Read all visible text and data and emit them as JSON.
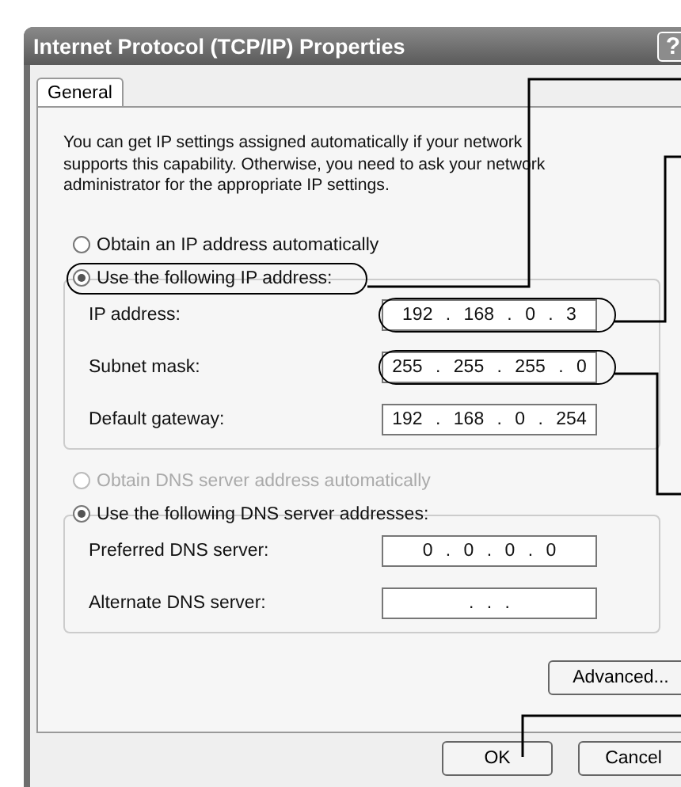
{
  "window": {
    "title": "Internet Protocol (TCP/IP) Properties",
    "title_buttons": [
      "?"
    ]
  },
  "tabs": [
    {
      "label": "General",
      "selected": true
    }
  ],
  "description": "You can get IP settings assigned automatically if your network supports this capability. Otherwise, you need to ask your network administrator for the appropriate IP settings.",
  "ip_options": [
    {
      "label": "Obtain an IP address automatically",
      "selected": false,
      "disabled": false
    },
    {
      "label": "Use the following IP address:",
      "selected": true,
      "disabled": false
    }
  ],
  "ip_fields": [
    {
      "label": "IP address:",
      "value": "192 . 168 . 0 . 3"
    },
    {
      "label": "Subnet mask:",
      "value": "255 . 255 . 255 . 0"
    },
    {
      "label": "Default gateway:",
      "value": "192 . 168 . 0 . 254"
    }
  ],
  "dns_options": [
    {
      "label": "Obtain DNS server address automatically",
      "selected": false,
      "disabled": true
    },
    {
      "label": "Use the following DNS server addresses:",
      "selected": true,
      "disabled": false
    }
  ],
  "dns_fields": [
    {
      "label": "Preferred DNS server:",
      "value": "0 . 0 . 0 . 0"
    },
    {
      "label": "Alternate DNS server:",
      "value": ". . ."
    }
  ],
  "advanced_button": "Advanced...",
  "buttons": [
    "OK",
    "Cancel"
  ]
}
